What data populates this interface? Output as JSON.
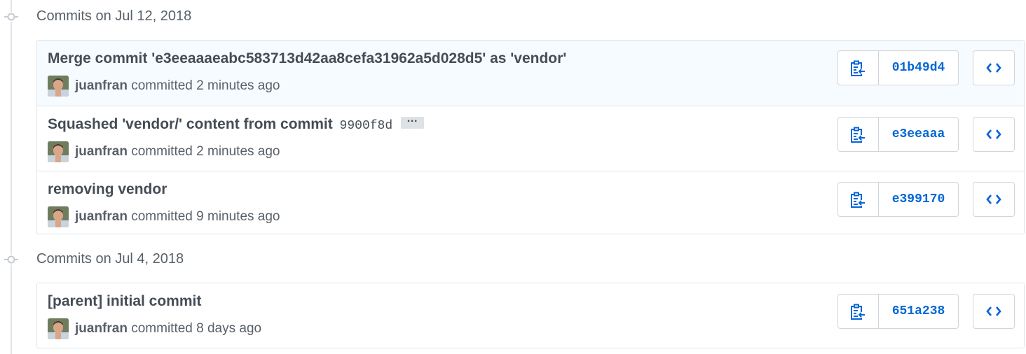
{
  "groups": [
    {
      "title": "Commits on Jul 12, 2018",
      "commits": [
        {
          "title": "Merge commit 'e3eeaaaeabc583713d42aa8cefa31962a5d028d5' as 'vendor'",
          "author": "juanfran",
          "meta": "committed 2 minutes ago",
          "sha": "01b49d4",
          "highlighted": true
        },
        {
          "title": "Squashed 'vendor/' content from commit",
          "inline_sha": "9900f8d",
          "ellipsis": "…",
          "author": "juanfran",
          "meta": "committed 2 minutes ago",
          "sha": "e3eeaaa"
        },
        {
          "title": "removing vendor",
          "author": "juanfran",
          "meta": "committed 9 minutes ago",
          "sha": "e399170"
        }
      ]
    },
    {
      "title": "Commits on Jul 4, 2018",
      "commits": [
        {
          "title": "[parent] initial commit",
          "author": "juanfran",
          "meta": "committed 8 days ago",
          "sha": "651a238"
        }
      ]
    }
  ],
  "icons": {
    "commit_node": "git-commit-icon",
    "copy": "clippy-icon",
    "browse": "code-icon"
  },
  "colors": {
    "link_blue": "#0366d6",
    "highlight_bg": "#f6fbff",
    "border": "#e1e4e8"
  }
}
